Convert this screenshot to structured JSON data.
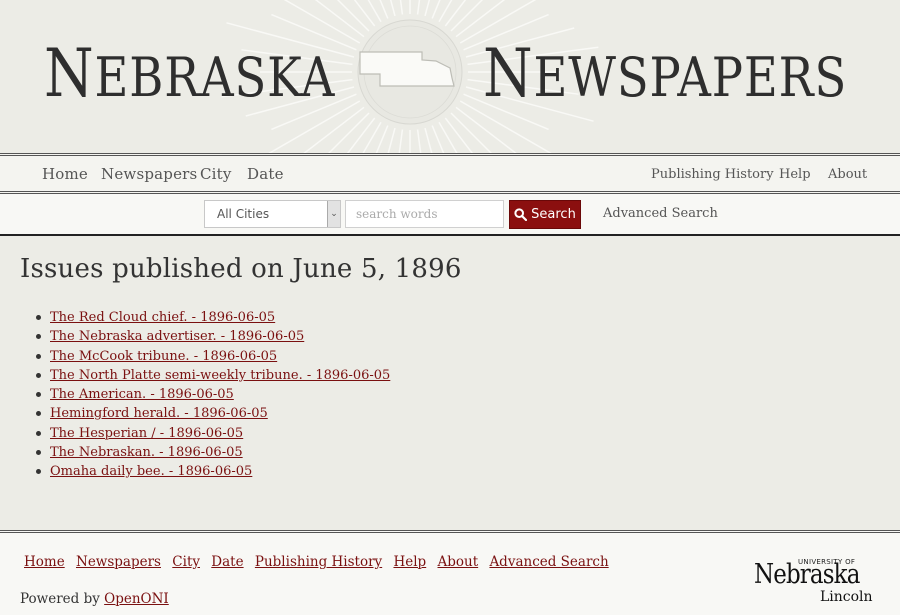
{
  "banner": {
    "title_left": "Nebraska",
    "title_right": "Newspapers"
  },
  "nav": {
    "main": [
      "Home",
      "Newspapers",
      "City",
      "Date"
    ],
    "side": [
      "Publishing History",
      "Help",
      "About"
    ]
  },
  "search": {
    "city_select": "All Cities",
    "placeholder": "search words",
    "button_label": "Search",
    "advanced_link": "Advanced Search"
  },
  "content": {
    "title": "Issues published on June 5, 1896",
    "issues": [
      "The Red Cloud chief. - 1896-06-05",
      "The Nebraska advertiser. - 1896-06-05",
      "The McCook tribune. - 1896-06-05",
      "The North Platte semi-weekly tribune. - 1896-06-05",
      "The American. - 1896-06-05",
      "Hemingford herald. - 1896-06-05",
      "The Hesperian / - 1896-06-05",
      "The Nebraskan. - 1896-06-05",
      "Omaha daily bee. - 1896-06-05"
    ]
  },
  "footer": {
    "links": [
      "Home",
      "Newspapers",
      "City",
      "Date",
      "Publishing History",
      "Help",
      "About",
      "Advanced Search"
    ],
    "powered_prefix": "Powered by",
    "powered_link": "OpenONI",
    "logo": {
      "university_of": "UNIVERSITY OF",
      "nebraska": "Nebraska",
      "lincoln": "Lincoln"
    }
  },
  "colors": {
    "accent": "#8b0f0f",
    "link": "#7a1010",
    "background": "#ecece6"
  }
}
